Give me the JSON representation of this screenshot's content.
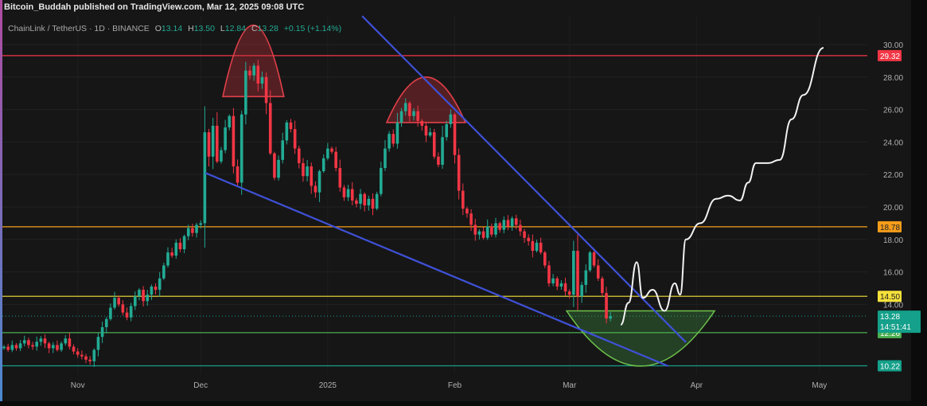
{
  "header": {
    "published": "Bitcoin_Buddah published on TradingView.com, Mar 12, 2025 09:08 UTC",
    "symbol": "ChainLink / TetherUS · 1D · BINANCE",
    "o_label": "O",
    "o": "13.14",
    "h_label": "H",
    "h": "13.50",
    "l_label": "L",
    "l": "12.84",
    "c_label": "C",
    "c": "13.28",
    "change": "+0.15 (+1.14%)"
  },
  "chart_data": {
    "type": "candlestick",
    "title": "ChainLink / TetherUS · 1D · BINANCE",
    "start_date": "2024-10-14",
    "interval": "1D",
    "closes": [
      11.4,
      11.2,
      11.5,
      11.3,
      11.6,
      11.8,
      11.5,
      11.4,
      11.7,
      11.9,
      11.6,
      11.3,
      11.5,
      11.2,
      11.6,
      11.9,
      11.4,
      11.1,
      10.9,
      10.8,
      10.6,
      10.5,
      11.2,
      12.0,
      12.6,
      13.1,
      13.8,
      14.4,
      14.0,
      13.5,
      13.2,
      13.9,
      14.5,
      14.9,
      14.2,
      14.6,
      15.1,
      14.9,
      15.6,
      16.4,
      17.2,
      17.0,
      17.8,
      17.4,
      18.2,
      18.7,
      18.4,
      18.9,
      19.0,
      24.6,
      23.1,
      25.0,
      22.8,
      23.5,
      24.9,
      25.6,
      22.5,
      21.5,
      25.7,
      28.4,
      28.1,
      28.7,
      27.6,
      28.0,
      26.4,
      23.3,
      21.8,
      22.9,
      24.1,
      25.2,
      24.8,
      23.6,
      22.7,
      21.9,
      22.5,
      21.3,
      20.9,
      22.2,
      23.0,
      23.6,
      23.4,
      22.4,
      21.2,
      20.6,
      21.1,
      20.4,
      20.2,
      20.8,
      20.1,
      20.5,
      19.9,
      20.8,
      22.4,
      23.6,
      24.5,
      23.9,
      25.2,
      25.9,
      26.4,
      25.6,
      25.9,
      25.3,
      25.0,
      24.4,
      24.6,
      23.1,
      22.6,
      24.3,
      25.1,
      25.7,
      23.2,
      21.0,
      19.9,
      19.6,
      18.9,
      18.3,
      18.5,
      18.1,
      18.8,
      18.3,
      19.0,
      18.6,
      19.2,
      18.8,
      19.3,
      18.9,
      18.5,
      18.1,
      17.9,
      17.3,
      17.8,
      17.2,
      16.4,
      15.3,
      15.6,
      15.1,
      15.3,
      14.8,
      14.6,
      17.3,
      14.5,
      15.2,
      16.1,
      17.2,
      16.4,
      15.6,
      14.7,
      13.13,
      13.28
    ],
    "y_ticks": [
      "30.00",
      "28.00",
      "26.00",
      "24.00",
      "22.00",
      "20.00",
      "18.00",
      "16.00",
      "14.00"
    ],
    "ylim": [
      9.5,
      31.5
    ],
    "x_ticks": [
      {
        "label": "Nov",
        "day": 18
      },
      {
        "label": "Dec",
        "day": 48
      },
      {
        "label": "2025",
        "day": 79
      },
      {
        "label": "Feb",
        "day": 110
      },
      {
        "label": "Mar",
        "day": 138
      },
      {
        "label": "Apr",
        "day": 169
      },
      {
        "label": "May",
        "day": 199
      }
    ],
    "levels": [
      {
        "price": 29.32,
        "label": "29.32",
        "color": "#f23645"
      },
      {
        "price": 18.78,
        "label": "18.78",
        "color": "#f59d1b"
      },
      {
        "price": 14.5,
        "label": "14.50",
        "color": "#f5e13b"
      },
      {
        "price": 12.26,
        "label": "12.26",
        "color": "#4caf50"
      },
      {
        "price": 10.22,
        "label": "10.22",
        "color": "#14a08a"
      }
    ],
    "last_price": {
      "price": 13.28,
      "label": "13.28",
      "countdown": "14:51:41",
      "color": "#14a08a"
    },
    "trendlines": [
      {
        "from": [
          87.4,
          31.76
        ],
        "to": [
          166.4,
          11.67
        ],
        "color": "#3f51d8"
      },
      {
        "from": [
          49.1,
          22.1
        ],
        "to": [
          162.1,
          10.2
        ],
        "color": "#3f51d8"
      }
    ],
    "tops": [
      {
        "from_day": 53.4,
        "to_day": 68.3,
        "base": 26.8,
        "apex": 31.2,
        "color": "#e0404a"
      },
      {
        "from_day": 93.4,
        "to_day": 112.6,
        "base": 25.2,
        "apex": 28.0,
        "color": "#e0404a"
      }
    ],
    "bowl": {
      "from_day": 137.3,
      "to_day": 173.4,
      "top": 13.6,
      "bottom": 10.2,
      "color": "#6cc04a"
    },
    "projection": [
      [
        150.5,
        12.75
      ],
      [
        152.4,
        14.1
      ],
      [
        154.4,
        16.6
      ],
      [
        155.9,
        14.4
      ],
      [
        158.3,
        14.9
      ],
      [
        161.2,
        13.6
      ],
      [
        163.7,
        15.3
      ],
      [
        165,
        14.6
      ],
      [
        166.4,
        18.0
      ],
      [
        169.9,
        19.0
      ],
      [
        173.8,
        20.5
      ],
      [
        176.7,
        20.7
      ],
      [
        179.6,
        20.4
      ],
      [
        181.6,
        21.5
      ],
      [
        183.5,
        22.7
      ],
      [
        186.4,
        22.7
      ],
      [
        189.3,
        22.9
      ],
      [
        192.2,
        25.4
      ],
      [
        195.1,
        26.9
      ],
      [
        200,
        29.8
      ]
    ],
    "colors": {
      "up": "#22ab94",
      "down": "#f23645",
      "bg": "#161616"
    }
  }
}
